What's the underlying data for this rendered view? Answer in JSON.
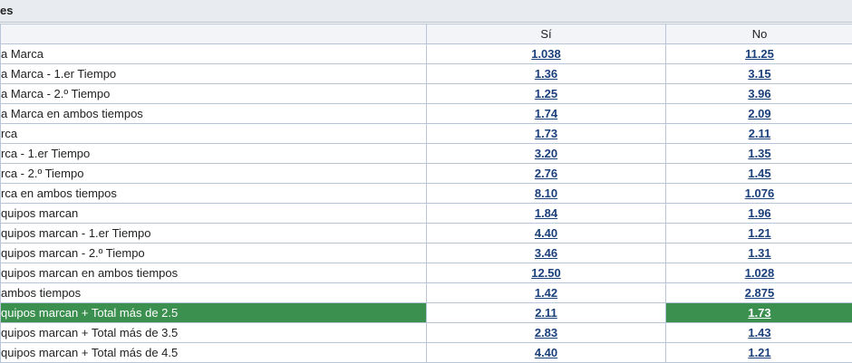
{
  "section": {
    "title": "es"
  },
  "columns": {
    "label": "",
    "yes": "Sí",
    "no": "No"
  },
  "colors": {
    "highlight": "#3b8f4f",
    "odds_link": "#1a3f7a",
    "header_bg": "#e8ebf0"
  },
  "rows": [
    {
      "label": "a Marca",
      "yes": "1.038",
      "no": "11.25"
    },
    {
      "label": "a Marca - 1.er Tiempo",
      "yes": "1.36",
      "no": "3.15"
    },
    {
      "label": "a Marca - 2.º Tiempo",
      "yes": "1.25",
      "no": "3.96"
    },
    {
      "label": "a Marca en ambos tiempos",
      "yes": "1.74",
      "no": "2.09"
    },
    {
      "label": "rca",
      "yes": "1.73",
      "no": "2.11"
    },
    {
      "label": "rca - 1.er Tiempo",
      "yes": "3.20",
      "no": "1.35"
    },
    {
      "label": "rca - 2.º Tiempo",
      "yes": "2.76",
      "no": "1.45"
    },
    {
      "label": "rca en ambos tiempos",
      "yes": "8.10",
      "no": "1.076"
    },
    {
      "label": "quipos marcan",
      "yes": "1.84",
      "no": "1.96"
    },
    {
      "label": "quipos marcan - 1.er Tiempo",
      "yes": "4.40",
      "no": "1.21"
    },
    {
      "label": "quipos marcan - 2.º Tiempo",
      "yes": "3.46",
      "no": "1.31"
    },
    {
      "label": "quipos marcan en ambos tiempos",
      "yes": "12.50",
      "no": "1.028"
    },
    {
      "label": " ambos tiempos",
      "yes": "1.42",
      "no": "2.875"
    },
    {
      "label": "quipos marcan + Total más de 2.5",
      "yes": "2.11",
      "no": "1.73",
      "highlight_label": true,
      "highlight_no": true
    },
    {
      "label": "quipos marcan + Total más de 3.5",
      "yes": "2.83",
      "no": "1.43"
    },
    {
      "label": "quipos marcan + Total más de 4.5",
      "yes": "4.40",
      "no": "1.21"
    }
  ]
}
